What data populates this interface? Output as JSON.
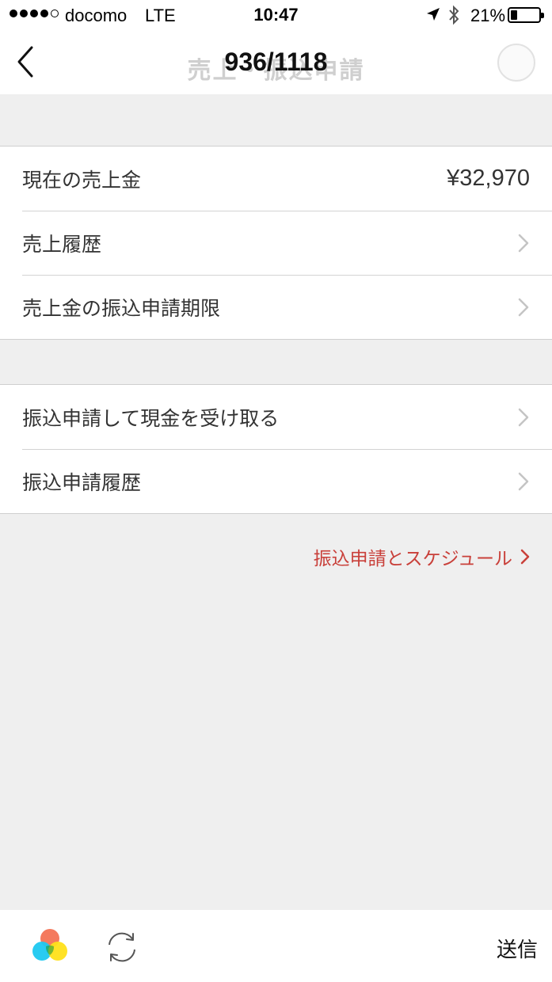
{
  "status_bar": {
    "carrier": "docomo",
    "network": "LTE",
    "time": "10:47",
    "battery_percent": "21%",
    "battery_level": 0.21
  },
  "nav": {
    "title": "売上・振込申請",
    "counter": "936/1118"
  },
  "sales_group": {
    "current_sales_label": "現在の売上金",
    "current_sales_value": "¥32,970",
    "sales_history_label": "売上履歴",
    "deadline_label": "売上金の振込申請期限"
  },
  "transfer_group": {
    "request_label": "振込申請して現金を受け取る",
    "history_label": "振込申請履歴"
  },
  "schedule_link": {
    "label": "振込申請とスケジュール"
  },
  "bottom_bar": {
    "send_label": "送信"
  },
  "colors": {
    "accent_red": "#c9403a",
    "background": "#efefef",
    "chevron": "#c4c4c4"
  }
}
